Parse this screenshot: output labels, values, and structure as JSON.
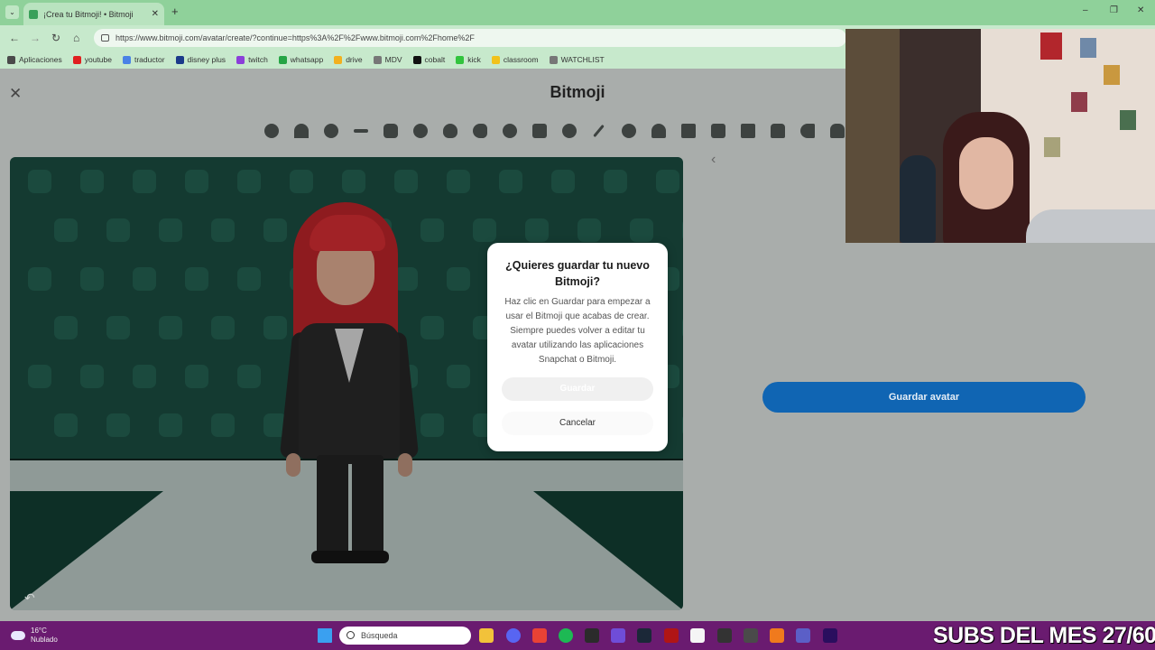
{
  "browser": {
    "tab_title": "¡Crea tu Bitmoji! • Bitmoji",
    "tab_close": "✕",
    "new_tab": "+",
    "window_controls": [
      "–",
      "❐",
      "✕"
    ],
    "url": "https://www.bitmoji.com/avatar/create/?continue=https%3A%2F%2Fwww.bitmoji.com%2Fhome%2F",
    "nav": {
      "back": "←",
      "forward": "→",
      "reload": "↻",
      "home": "⌂"
    },
    "bookmarks": [
      {
        "label": "Aplicaciones",
        "color": "#4a4a4a"
      },
      {
        "label": "youtube",
        "color": "#e02020"
      },
      {
        "label": "traductor",
        "color": "#4a82e6"
      },
      {
        "label": "disney plus",
        "color": "#1b3a8a"
      },
      {
        "label": "twitch",
        "color": "#8b3fd9"
      },
      {
        "label": "whatsapp",
        "color": "#25a545"
      },
      {
        "label": "drive",
        "color": "#f2b01e"
      },
      {
        "label": "MDV",
        "color": "#777777"
      },
      {
        "label": "cobalt",
        "color": "#111111"
      },
      {
        "label": "kick",
        "color": "#31c43d"
      },
      {
        "label": "classroom",
        "color": "#f1c21b"
      },
      {
        "label": "WATCHLIST",
        "color": "#777777"
      }
    ]
  },
  "page": {
    "close": "✕",
    "brand": "Bitmoji",
    "category_icons": [
      "face-shape-icon",
      "hair-icon",
      "eye-icon",
      "eyebrow-icon",
      "nose-icon",
      "cheek-icon",
      "mouth-icon",
      "ear-icon",
      "face-lines-icon",
      "body-icon",
      "face-accessory-icon",
      "makeup-icon",
      "glasses-icon",
      "hat-icon",
      "hanger-icon",
      "shirt-icon",
      "pants-icon",
      "dress-icon",
      "shoe-icon",
      "outerwear-icon"
    ],
    "chevron": "‹",
    "undo": "↶",
    "save_avatar": "Guardar avatar"
  },
  "modal": {
    "title": "¿Quieres guardar tu nuevo Bitmoji?",
    "body": "Haz clic en Guardar para empezar a usar el Bitmoji que acabas de crear. Siempre puedes volver a editar tu avatar utilizando las aplicaciones Snapchat o Bitmoji.",
    "save": "Guardar",
    "cancel": "Cancelar"
  },
  "taskbar": {
    "temp": "16°C",
    "condition": "Nublado",
    "search_placeholder": "Búsqueda",
    "icons": [
      {
        "name": "start-icon",
        "color": "#3aa0f0"
      },
      {
        "name": "file-explorer-icon",
        "color": "#f2c23a"
      },
      {
        "name": "discord-icon",
        "color": "#5865f2"
      },
      {
        "name": "chrome-icon",
        "color": "#e94235"
      },
      {
        "name": "spotify-icon",
        "color": "#1db954"
      },
      {
        "name": "obs-icon",
        "color": "#2b2b2b"
      },
      {
        "name": "app-icon",
        "color": "#6f4dd8"
      },
      {
        "name": "steam-icon",
        "color": "#1b2838"
      },
      {
        "name": "app-icon",
        "color": "#b01515"
      },
      {
        "name": "notion-icon",
        "color": "#f5f5f5"
      },
      {
        "name": "notion-icon",
        "color": "#333333"
      },
      {
        "name": "chatgpt-icon",
        "color": "#4a4a4a"
      },
      {
        "name": "fl-studio-icon",
        "color": "#f07a1d"
      },
      {
        "name": "teams-icon",
        "color": "#5b5fc7"
      },
      {
        "name": "premiere-icon",
        "color": "#2a0e5e"
      }
    ],
    "overlay": "SUBS DEL MES 27/60"
  },
  "colors": {
    "accent": "#1065b3",
    "tabstrip": "#8fd19a",
    "taskbar": "#6a1b70"
  }
}
